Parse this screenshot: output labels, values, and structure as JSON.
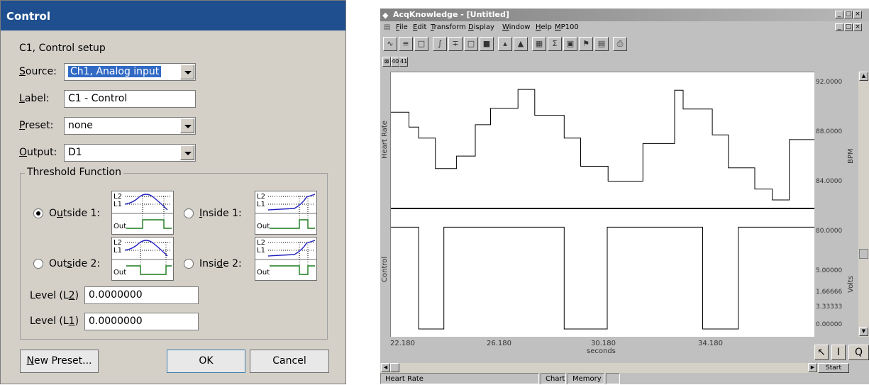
{
  "dialog": {
    "title": "Control",
    "subtitle": "C1, Control setup",
    "source": {
      "prefix": "S",
      "label": "ource:",
      "value": "Ch1, Analog input"
    },
    "label_field": {
      "prefix": "L",
      "label": "abel:",
      "value": "C1 - Control"
    },
    "preset": {
      "prefix": "P",
      "label": "reset:",
      "value": "none"
    },
    "output": {
      "prefix": "O",
      "label": "utput:",
      "value": "D1"
    },
    "threshold_group": "Threshold Function",
    "options": {
      "outside1": {
        "a": "O",
        "u": "u",
        "b": "tside 1:"
      },
      "inside1": {
        "u": "I",
        "b": "nside 1:"
      },
      "outside2": {
        "a": "Out",
        "u": "s",
        "b": "ide 2:"
      },
      "inside2": {
        "a": "Insi",
        "u": "d",
        "b": "e 2:"
      },
      "selected": "outside1"
    },
    "thumb_labels": {
      "l2": "L2",
      "l1": "L1",
      "out": "Out"
    },
    "level_l2": {
      "label_a": "Level (L",
      "u": "2",
      "label_b": ")",
      "value": "0.0000000"
    },
    "level_l1": {
      "label_a": "Level (L",
      "u": "1",
      "label_b": ")",
      "value": "0.0000000"
    },
    "buttons": {
      "new_preset_u": "N",
      "new_preset": "ew Preset...",
      "ok": "OK",
      "cancel": "Cancel"
    }
  },
  "acq": {
    "title": "AcqKnowledge - [Untitled]",
    "menu": [
      {
        "u": "F",
        "rest": "ile"
      },
      {
        "u": "E",
        "rest": "dit"
      },
      {
        "u": "T",
        "rest": "ransform"
      },
      {
        "u": "D",
        "rest": "isplay"
      },
      {
        "u": "W",
        "rest": "indow"
      },
      {
        "u": "H",
        "rest": "elp"
      },
      {
        "u": "M",
        "rest": "P100"
      }
    ],
    "channel_buttons": [
      "40",
      "41"
    ],
    "heart_label": "Heart Rate",
    "control_label": "Control",
    "hr_ticks": [
      "92.0000",
      "88.0000",
      "84.0000",
      "80.0000"
    ],
    "ctrl_ticks": [
      "5.00000",
      "3.33333",
      "1.66666",
      "0.00000"
    ],
    "hr_unit": "BPM",
    "ctrl_unit": "Volts",
    "x_ticks": [
      "22.180",
      "26.180",
      "30.180",
      "34.180"
    ],
    "x_unit": "seconds",
    "status": {
      "channel": "Heart Rate",
      "mode": "Chart",
      "memory": "Memory"
    },
    "start_label": "Start"
  },
  "chart_data": {
    "type": "line",
    "xlabel": "seconds",
    "x_ticks": [
      22.18,
      26.18,
      30.18,
      34.18
    ],
    "series": [
      {
        "name": "Heart Rate",
        "unit": "BPM",
        "ylim": [
          77.3,
          94.3
        ],
        "x": [
          22.18,
          22.82,
          22.82,
          23.16,
          23.16,
          23.75,
          23.75,
          24.5,
          24.5,
          25.16,
          25.16,
          25.7,
          25.7,
          26.67,
          26.67,
          27.26,
          27.26,
          28.3,
          28.3,
          28.88,
          28.88,
          29.85,
          29.85,
          31.08,
          31.08,
          32.2,
          32.2,
          32.5,
          32.5,
          33.53,
          33.53,
          34.1,
          34.1,
          35.03,
          35.03,
          35.65,
          35.65,
          36.25,
          36.25,
          37.16
        ],
        "y": [
          89.4,
          89.4,
          87.5,
          87.5,
          86.1,
          86.1,
          82.2,
          82.2,
          83.8,
          83.8,
          87.8,
          87.8,
          89.9,
          89.9,
          92.3,
          92.3,
          89.0,
          89.0,
          86.1,
          86.1,
          82.5,
          82.5,
          80.6,
          80.6,
          85.4,
          85.4,
          92.2,
          92.2,
          89.8,
          89.8,
          86.5,
          86.5,
          82.3,
          82.3,
          79.6,
          79.6,
          78.2,
          78.2,
          85.9,
          85.9
        ]
      },
      {
        "name": "Control",
        "unit": "Volts",
        "ylim": [
          -0.35,
          5.85
        ],
        "x": [
          22.18,
          23.16,
          23.16,
          24.05,
          24.05,
          28.3,
          28.3,
          29.82,
          29.82,
          33.19,
          33.19,
          34.45,
          34.45,
          37.16
        ],
        "y": [
          5.0,
          5.0,
          0.0,
          0.0,
          5.0,
          5.0,
          0.0,
          0.0,
          5.0,
          5.0,
          0.0,
          0.0,
          5.0,
          5.0
        ]
      }
    ]
  }
}
